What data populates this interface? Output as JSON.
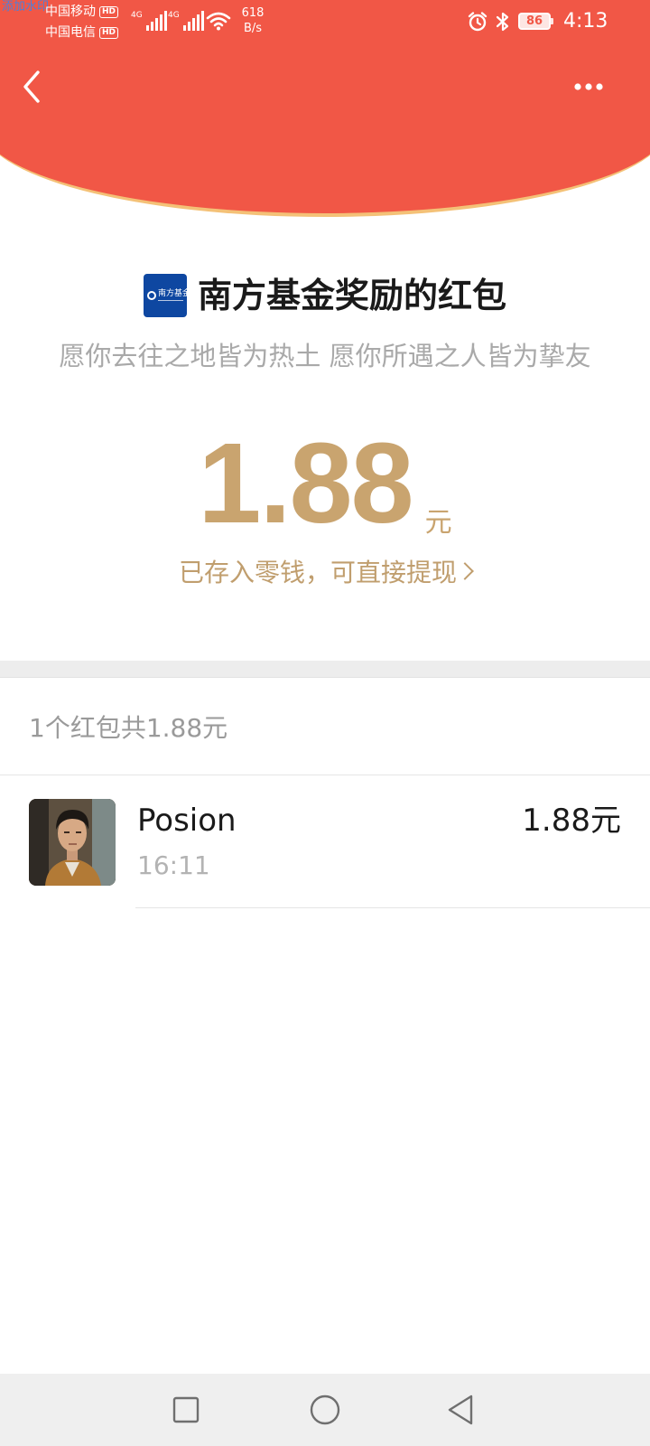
{
  "status_bar": {
    "watermark": "添加水印",
    "carrier_1": "中国移动",
    "carrier_2": "中国电信",
    "hd_badge": "HD",
    "network_type": "4G",
    "net_speed_value": "618",
    "net_speed_unit": "B/s",
    "battery_level": "86",
    "time": "4:13",
    "icons": [
      "wifi-icon",
      "alarm-icon",
      "bluetooth-icon",
      "battery-icon"
    ]
  },
  "nav": {
    "back_icon": "chevron-left-icon",
    "more_icon": "more-dots-icon"
  },
  "sender": {
    "logo_text": "南方基金",
    "title": "南方基金奖励的红包",
    "blessing": "愿你去往之地皆为热土 愿你所遇之人皆为挚友"
  },
  "amount": {
    "value": "1.88",
    "unit": "元",
    "deposit_link": "已存入零钱，可直接提现"
  },
  "summary": "1个红包共1.88元",
  "records": [
    {
      "name": "Posion",
      "time": "16:11",
      "amount": "1.88元"
    }
  ],
  "system_nav": {
    "icons": [
      "recent-apps-icon",
      "home-icon",
      "back-triangle-icon"
    ]
  },
  "colors": {
    "header_red": "#F15746",
    "header_rim": "#F4C177",
    "gold": "#C9A46F",
    "separator": "#EDEDED"
  }
}
